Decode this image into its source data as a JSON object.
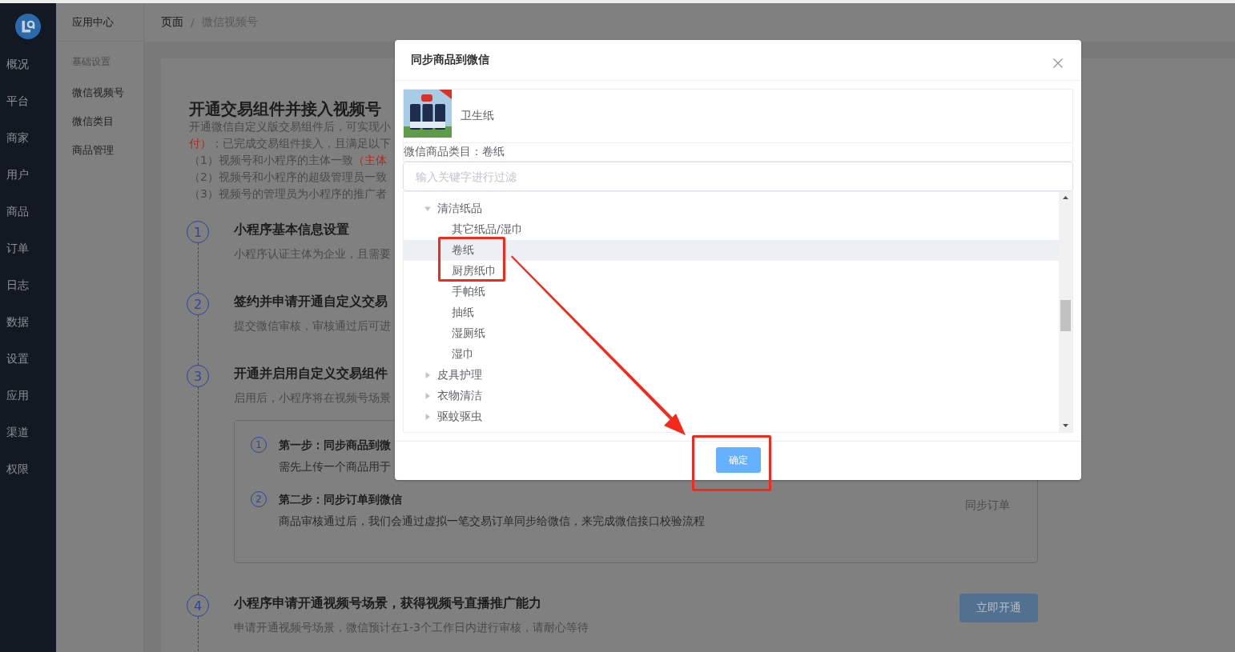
{
  "nav": {
    "items": [
      "概况",
      "平台",
      "商家",
      "用户",
      "商品",
      "订单",
      "日志",
      "数据",
      "设置",
      "应用",
      "渠道",
      "权限"
    ]
  },
  "subnav": {
    "title": "应用中心",
    "group": "基础设置",
    "items": [
      "微信视频号",
      "微信类目",
      "商品管理"
    ]
  },
  "breadcrumb": {
    "items": [
      "页面",
      "微信视频号"
    ],
    "separator": "/"
  },
  "page": {
    "title": "开通交易组件并接入视频号",
    "intro": [
      {
        "segments": [
          {
            "text": "开通微信自定义版交易组件后，可实现小",
            "highlight": false
          }
        ]
      },
      {
        "segments": [
          {
            "text": "付）",
            "highlight": true
          },
          {
            "text": "；已完成交易组件接入，且满足以下",
            "highlight": false
          }
        ]
      }
    ],
    "requirements": [
      {
        "segments": [
          {
            "text": "（1）视频号和小程序的主体一致",
            "highlight": false
          },
          {
            "text": "（主体",
            "highlight": true
          }
        ]
      },
      {
        "segments": [
          {
            "text": "（2）视频号和小程序的超级管理员一致",
            "highlight": false
          }
        ]
      },
      {
        "segments": [
          {
            "text": "（3）视频号的管理员为小程序的推广者",
            "highlight": false
          }
        ]
      }
    ],
    "steps": [
      {
        "number": "1",
        "title": "小程序基本信息设置",
        "description": "小程序认证主体为企业，且需要"
      },
      {
        "number": "2",
        "title": "签约并申请开通自定义交易",
        "description": "提交微信审核，审核通过后可进"
      },
      {
        "number": "3",
        "title": "开通并启用自定义交易组件",
        "description": "启用后，小程序将在视频号场景",
        "substeps": [
          {
            "number": "1",
            "title": "第一步：同步商品到微",
            "description": "需先上传一个商品用于"
          },
          {
            "number": "2",
            "title": "第二步：同步订单到微信",
            "description": "商品审核通过后，我们会通过虚拟一笔交易订单同步给微信，来完成微信接口校验流程",
            "action": "同步订单"
          }
        ]
      },
      {
        "number": "4",
        "title": "小程序申请开通视频号场景，获得视频号直播推广能力",
        "description": "申请开通视频号场景，微信预计在1-3个工作日内进行审核，请耐心等待",
        "button": {
          "label": "立即开通",
          "disabled": true
        }
      }
    ]
  },
  "modal": {
    "title": "同步商品到微信",
    "product": {
      "name": "卫生纸"
    },
    "category": "微信商品类目：卷纸",
    "filter": {
      "placeholder": "输入关键字进行过滤"
    },
    "tree": [
      {
        "label": "清洁纸品",
        "expanded": true,
        "selected": false,
        "children": [
          {
            "label": "其它纸品/湿巾",
            "selected": false
          },
          {
            "label": "卷纸",
            "selected": true
          },
          {
            "label": "厨房纸巾",
            "selected": false
          },
          {
            "label": "手帕纸",
            "selected": false
          },
          {
            "label": "抽纸",
            "selected": false
          },
          {
            "label": "湿厕纸",
            "selected": false
          },
          {
            "label": "湿巾",
            "selected": false
          }
        ]
      },
      {
        "label": "皮具护理",
        "expanded": false,
        "selected": false
      },
      {
        "label": "衣物清洁",
        "expanded": false,
        "selected": false
      },
      {
        "label": "驱蚊驱虫",
        "expanded": false,
        "selected": false
      }
    ],
    "confirm": "确定"
  },
  "annotations": [
    {
      "kind": "box"
    },
    {
      "kind": "arrow"
    },
    {
      "kind": "box"
    }
  ]
}
